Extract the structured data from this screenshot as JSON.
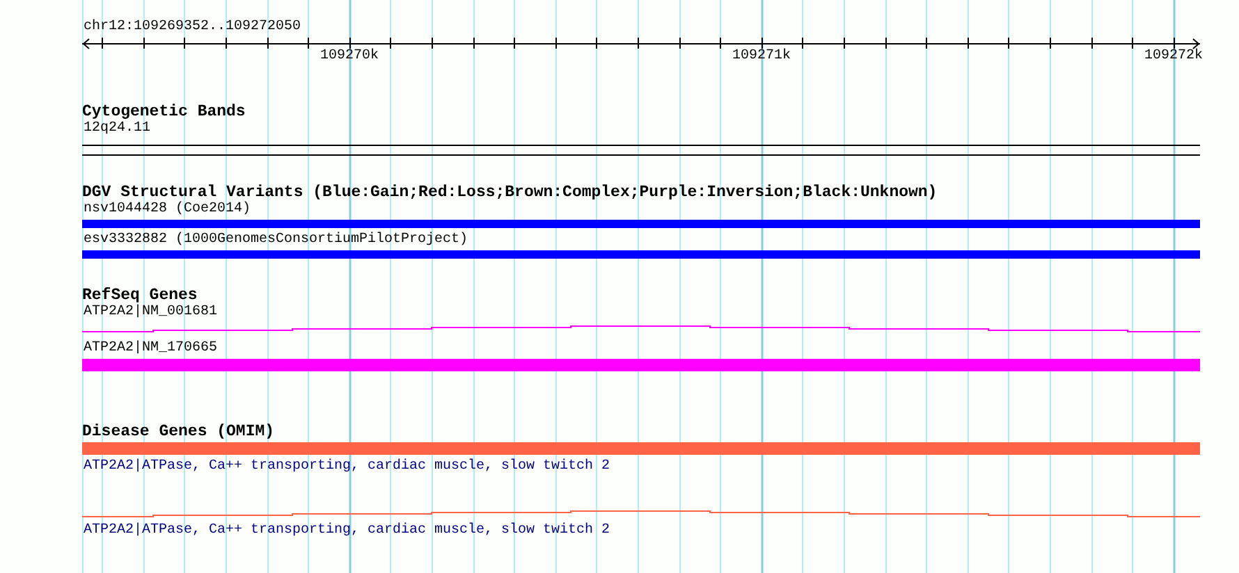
{
  "ruler": {
    "range": "chr12:109269352..109272050",
    "ticks": [
      {
        "label": "109270k"
      },
      {
        "label": "109271k"
      },
      {
        "label": "109272k"
      }
    ]
  },
  "tracks": [
    {
      "kind": "bands",
      "title": "Cytogenetic Bands",
      "features": [
        {
          "kind": "band",
          "label": "12q24.11"
        }
      ]
    },
    {
      "kind": "variants",
      "title": "DGV Structural Variants (Blue:Gain;Red:Loss;Brown:Complex;Purple:Inversion;Black:Unknown)",
      "features": [
        {
          "kind": "bar",
          "label": "nsv1044428 (Coe2014)",
          "color": "#0000ff"
        },
        {
          "kind": "bar",
          "label": "esv3332882 (1000GenomesConsortiumPilotProject)",
          "color": "#0000ff"
        }
      ]
    },
    {
      "kind": "genes",
      "title": "RefSeq Genes",
      "features": [
        {
          "kind": "line",
          "label": "ATP2A2|NM_001681",
          "color": "#ff00ff"
        },
        {
          "kind": "bar",
          "label": "ATP2A2|NM_170665",
          "color": "#ff00ff"
        }
      ]
    },
    {
      "kind": "disease",
      "title": "Disease Genes (OMIM)",
      "features": [
        {
          "kind": "bar",
          "label": "ATP2A2|ATPase, Ca++ transporting, cardiac muscle, slow twitch 2",
          "color": "#ff6347"
        },
        {
          "kind": "line",
          "label": "ATP2A2|ATPase, Ca++ transporting, cardiac muscle, slow twitch 2",
          "color": "#ff6347"
        }
      ]
    }
  ]
}
